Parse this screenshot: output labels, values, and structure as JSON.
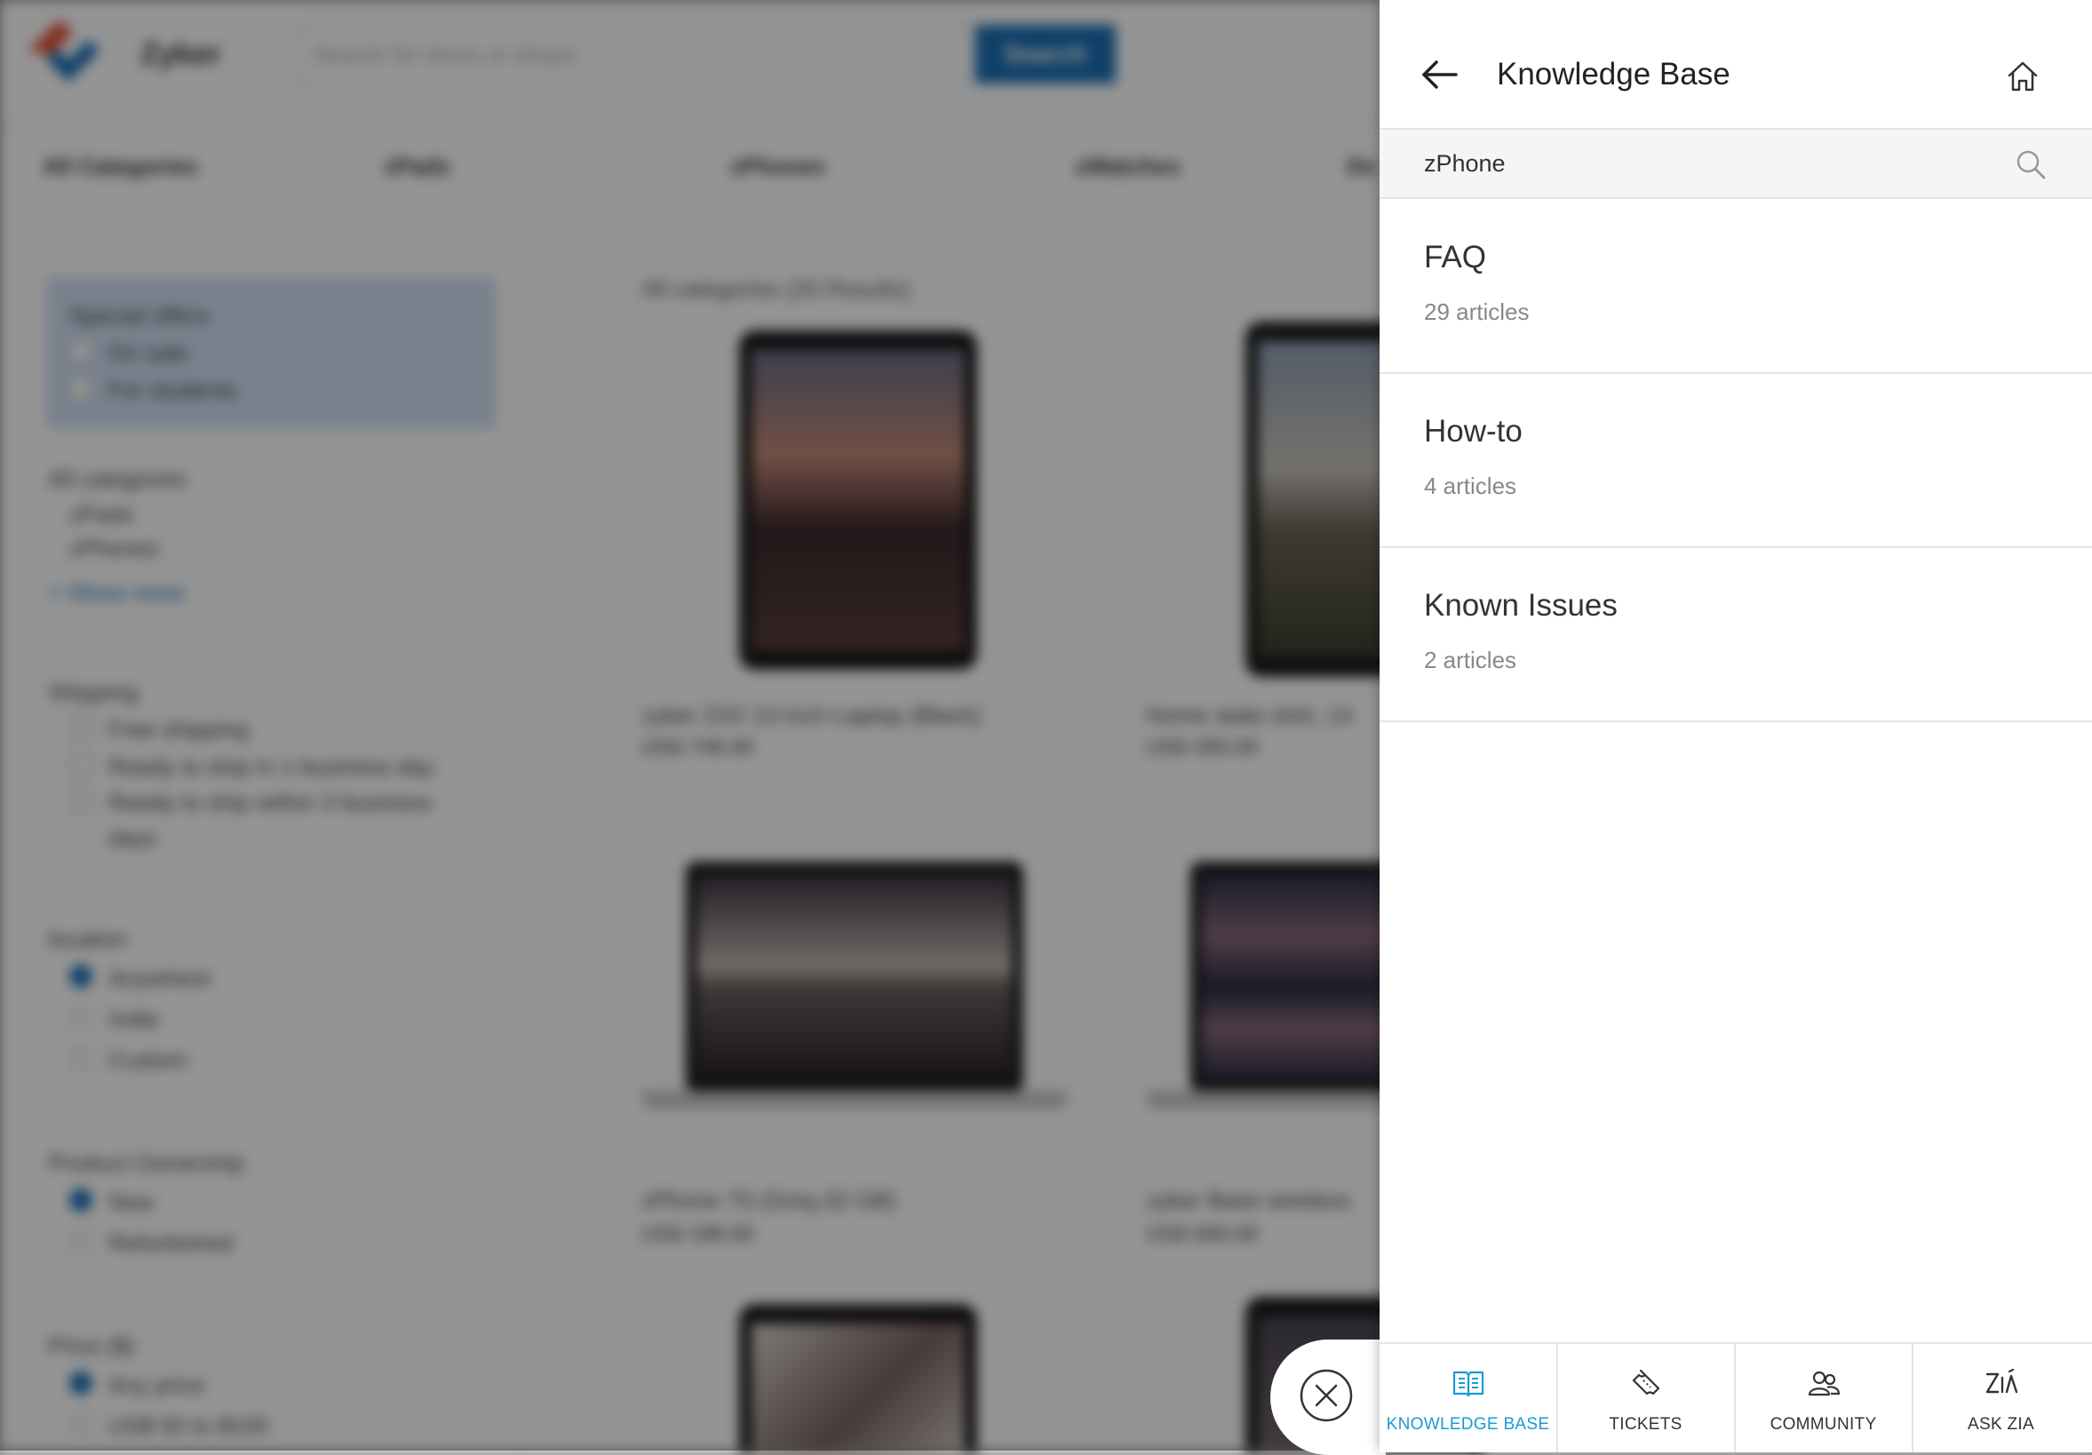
{
  "background": {
    "brand": "Zyker",
    "search_placeholder": "Search for items or shops",
    "search_button": "Search",
    "categories_nav": [
      "All Categories",
      "zPads",
      "zPhones",
      "zWatches",
      "De"
    ],
    "sidebar": {
      "special_offers_title": "Special offers",
      "on_sale": "On sale",
      "for_students": "For students",
      "all_categories_title": "All categories",
      "cat_items": [
        "zPads",
        "zPhones"
      ],
      "show_more": "+ Show more",
      "shipping_title": "Shipping",
      "shipping_items": [
        "Free shipping",
        "Ready to ship in 1 business day",
        "Ready to ship within 3 business",
        "days"
      ],
      "location_title": "location",
      "location_items": [
        "Anywhere",
        "India",
        "Custom"
      ],
      "ownership_title": "Product Ownership",
      "ownership_items": [
        "New",
        "Refurbished"
      ],
      "price_title": "Price ($)",
      "price_items": [
        "Any price",
        "US$ 50 to $100"
      ]
    },
    "results_heading": "All categories (20 Results)",
    "products": [
      {
        "title": "zyker ZX2 13 inch Laptop (Black)",
        "price": "US$ 749.00"
      },
      {
        "title": "Home state shirt, 14",
        "price": "US$ 350.00"
      },
      {
        "title": "zPhone 7S (Grey,32 GB)",
        "price": "US$ 199.00"
      },
      {
        "title": "zyker Base wireless",
        "price": "US$ 600.00"
      }
    ]
  },
  "panel": {
    "title": "Knowledge Base",
    "search_value": "zPhone",
    "search_placeholder": "",
    "categories": [
      {
        "name": "FAQ",
        "count": "29 articles"
      },
      {
        "name": "How-to",
        "count": "4 articles"
      },
      {
        "name": "Known Issues",
        "count": "2 articles"
      }
    ],
    "tabs": [
      {
        "label": "KNOWLEDGE BASE",
        "icon": "book-icon",
        "active": true
      },
      {
        "label": "TICKETS",
        "icon": "ticket-icon",
        "active": false
      },
      {
        "label": "COMMUNITY",
        "icon": "community-icon",
        "active": false
      },
      {
        "label": "ASK ZIA",
        "icon": "zia-icon",
        "active": false
      }
    ],
    "accent_color": "#1a9ad6"
  }
}
